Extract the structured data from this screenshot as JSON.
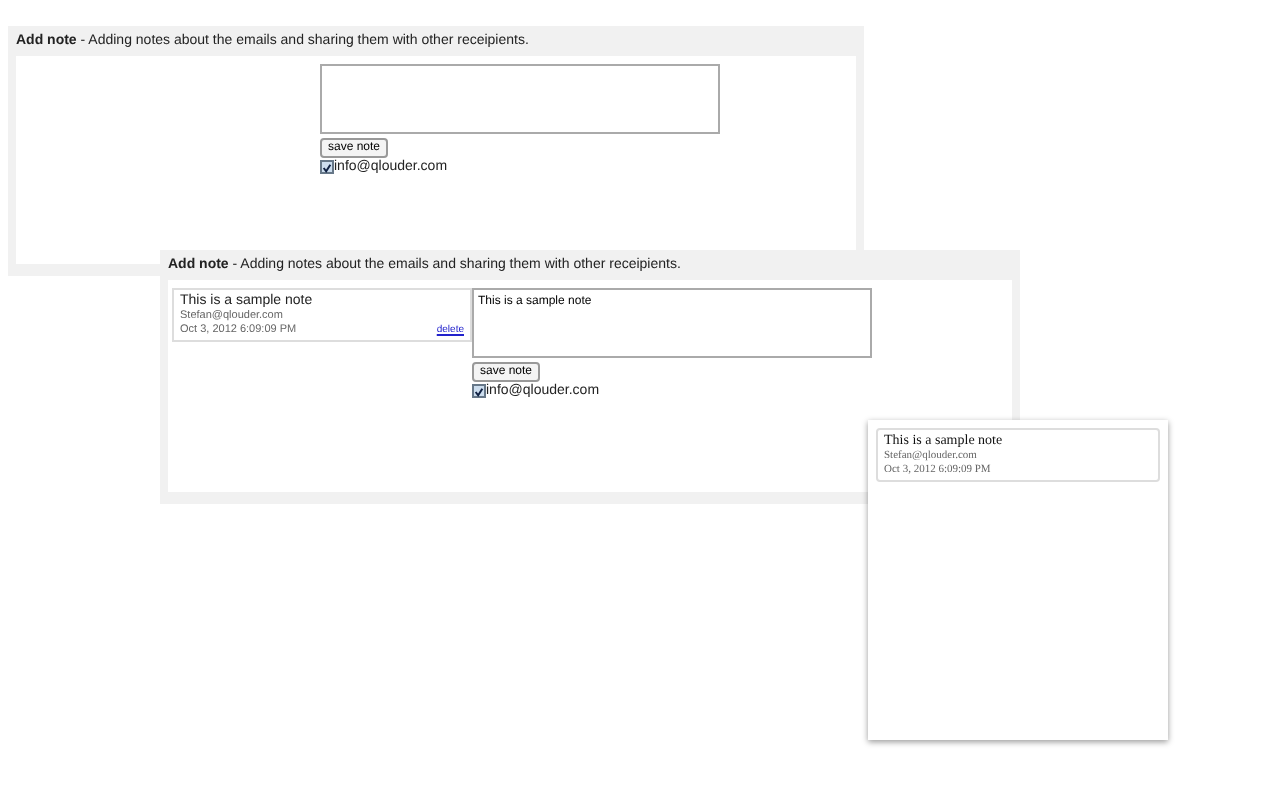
{
  "panels": [
    {
      "kind": "editor",
      "header": {
        "title": "Add note",
        "description": " - Adding notes about the emails and sharing them with other receipients."
      },
      "save_button": "save note",
      "recipients": [
        {
          "email": "info@qlouder.com",
          "checked": true
        }
      ]
    },
    {
      "kind": "editor",
      "header": {
        "title": "Add note",
        "description": " - Adding notes about the emails and sharing them with other receipients."
      },
      "notes": [
        {
          "text": "This is a sample note",
          "author": "Stefan@qlouder.com",
          "date": "Oct 3, 2012 6:09:09 PM",
          "delete": "delete"
        }
      ],
      "textarea": {
        "value": "This is a sample note"
      },
      "save_button": "save note",
      "recipients": [
        {
          "email": "info@qlouder.com",
          "checked": true
        }
      ]
    },
    {
      "kind": "popup",
      "notes": [
        {
          "text": "This is a sample note",
          "author": "Stefan@qlouder.com",
          "date": "Oct 3, 2012 6:09:09 PM"
        }
      ]
    }
  ]
}
